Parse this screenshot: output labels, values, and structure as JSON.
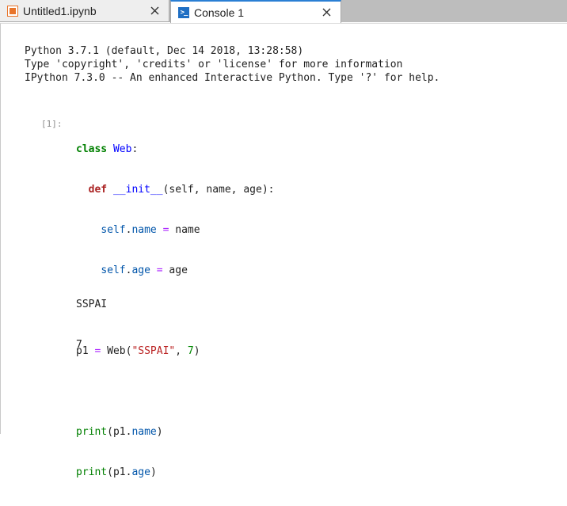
{
  "tabs": [
    {
      "label": "Untitled1.ipynb",
      "icon": "notebook-icon",
      "active": false
    },
    {
      "label": "Console 1",
      "icon": "console-icon",
      "active": true
    }
  ],
  "console_icon_glyph": ">_",
  "banner": [
    "Python 3.7.1 (default, Dec 14 2018, 13:28:58)",
    "Type 'copyright', 'credits' or 'license' for more information",
    "IPython 7.3.0 -- An enhanced Interactive Python. Type '?' for help."
  ],
  "cell": {
    "prompt": "[1]:",
    "code": {
      "line1": {
        "kw": "class",
        "name": "Web",
        "rest": ":"
      },
      "line2": {
        "kw": "def",
        "name": "__init__",
        "rest": "(self, name, age):"
      },
      "line3": {
        "obj": "self",
        "dot": ".",
        "attr": "name",
        "eq": "=",
        "val": "name"
      },
      "line4": {
        "obj": "self",
        "dot": ".",
        "attr": "age",
        "eq": "=",
        "val": "age"
      },
      "line5": {
        "var": "p1",
        "eq": "=",
        "call": "Web(",
        "str": "\"SSPAI\"",
        "comma": ", ",
        "num": "7",
        "close": ")"
      },
      "line6": {
        "fn": "print",
        "open": "(p1.",
        "attr": "name",
        "close": ")"
      },
      "line7": {
        "fn": "print",
        "open": "(p1.",
        "attr": "age",
        "close": ")"
      }
    },
    "output": [
      "SSPAI",
      "7"
    ]
  },
  "colors": {
    "active_tab_accent": "#2a7fd4",
    "notebook_icon": "#e8742a",
    "console_icon": "#1f6fc4",
    "keyword": "#008000",
    "def_keyword": "#aa2222",
    "name": "#0000ff",
    "string": "#ba2121",
    "operator": "#aa22ff"
  }
}
